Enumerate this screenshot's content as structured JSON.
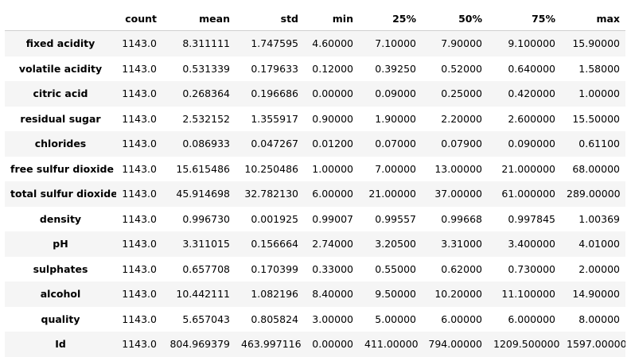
{
  "table": {
    "columns": [
      "",
      "count",
      "mean",
      "std",
      "min",
      "25%",
      "50%",
      "75%",
      "max"
    ],
    "rows": [
      {
        "label": "fixed acidity",
        "values": [
          "1143.0",
          "8.311111",
          "1.747595",
          "4.60000",
          "7.10000",
          "7.90000",
          "9.100000",
          "15.90000"
        ]
      },
      {
        "label": "volatile acidity",
        "values": [
          "1143.0",
          "0.531339",
          "0.179633",
          "0.12000",
          "0.39250",
          "0.52000",
          "0.640000",
          "1.58000"
        ]
      },
      {
        "label": "citric acid",
        "values": [
          "1143.0",
          "0.268364",
          "0.196686",
          "0.00000",
          "0.09000",
          "0.25000",
          "0.420000",
          "1.00000"
        ]
      },
      {
        "label": "residual sugar",
        "values": [
          "1143.0",
          "2.532152",
          "1.355917",
          "0.90000",
          "1.90000",
          "2.20000",
          "2.600000",
          "15.50000"
        ]
      },
      {
        "label": "chlorides",
        "values": [
          "1143.0",
          "0.086933",
          "0.047267",
          "0.01200",
          "0.07000",
          "0.07900",
          "0.090000",
          "0.61100"
        ]
      },
      {
        "label": "free sulfur dioxide",
        "values": [
          "1143.0",
          "15.615486",
          "10.250486",
          "1.00000",
          "7.00000",
          "13.00000",
          "21.000000",
          "68.00000"
        ]
      },
      {
        "label": "total sulfur dioxide",
        "values": [
          "1143.0",
          "45.914698",
          "32.782130",
          "6.00000",
          "21.00000",
          "37.00000",
          "61.000000",
          "289.00000"
        ]
      },
      {
        "label": "density",
        "values": [
          "1143.0",
          "0.996730",
          "0.001925",
          "0.99007",
          "0.99557",
          "0.99668",
          "0.997845",
          "1.00369"
        ]
      },
      {
        "label": "pH",
        "values": [
          "1143.0",
          "3.311015",
          "0.156664",
          "2.74000",
          "3.20500",
          "3.31000",
          "3.400000",
          "4.01000"
        ]
      },
      {
        "label": "sulphates",
        "values": [
          "1143.0",
          "0.657708",
          "0.170399",
          "0.33000",
          "0.55000",
          "0.62000",
          "0.730000",
          "2.00000"
        ]
      },
      {
        "label": "alcohol",
        "values": [
          "1143.0",
          "10.442111",
          "1.082196",
          "8.40000",
          "9.50000",
          "10.20000",
          "11.100000",
          "14.90000"
        ]
      },
      {
        "label": "quality",
        "values": [
          "1143.0",
          "5.657043",
          "0.805824",
          "3.00000",
          "5.00000",
          "6.00000",
          "6.000000",
          "8.00000"
        ]
      },
      {
        "label": "Id",
        "values": [
          "1143.0",
          "804.969379",
          "463.997116",
          "0.00000",
          "411.00000",
          "794.00000",
          "1209.500000",
          "1597.00000"
        ]
      }
    ]
  }
}
